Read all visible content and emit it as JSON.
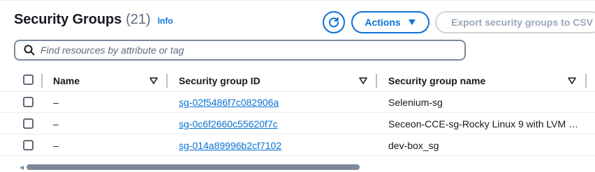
{
  "header": {
    "title": "Security Groups",
    "count": "(21)",
    "info_label": "Info"
  },
  "toolbar": {
    "actions_label": "Actions",
    "export_label": "Export security groups to CSV"
  },
  "search": {
    "placeholder": "Find resources by attribute or tag",
    "value": ""
  },
  "table": {
    "columns": [
      "Name",
      "Security group ID",
      "Security group name"
    ],
    "rows": [
      {
        "name": "–",
        "group_id": "sg-02f5486f7c082906a",
        "group_name": "Selenium-sg"
      },
      {
        "name": "–",
        "group_id": "sg-0c6f2660c55620f7c",
        "group_name": "Seceon-CCE-sg-Rocky Linux 9 with LVM …"
      },
      {
        "name": "–",
        "group_id": "sg-014a89996b2cf7102",
        "group_name": "dev-box_sg"
      }
    ]
  },
  "colors": {
    "accent": "#0972d3",
    "text": "#16191f",
    "muted": "#5f6b7a",
    "disabled": "#9ba7b6"
  },
  "icons": [
    "refresh-icon",
    "caret-down-icon",
    "search-icon",
    "sort-icon",
    "checkbox"
  ]
}
